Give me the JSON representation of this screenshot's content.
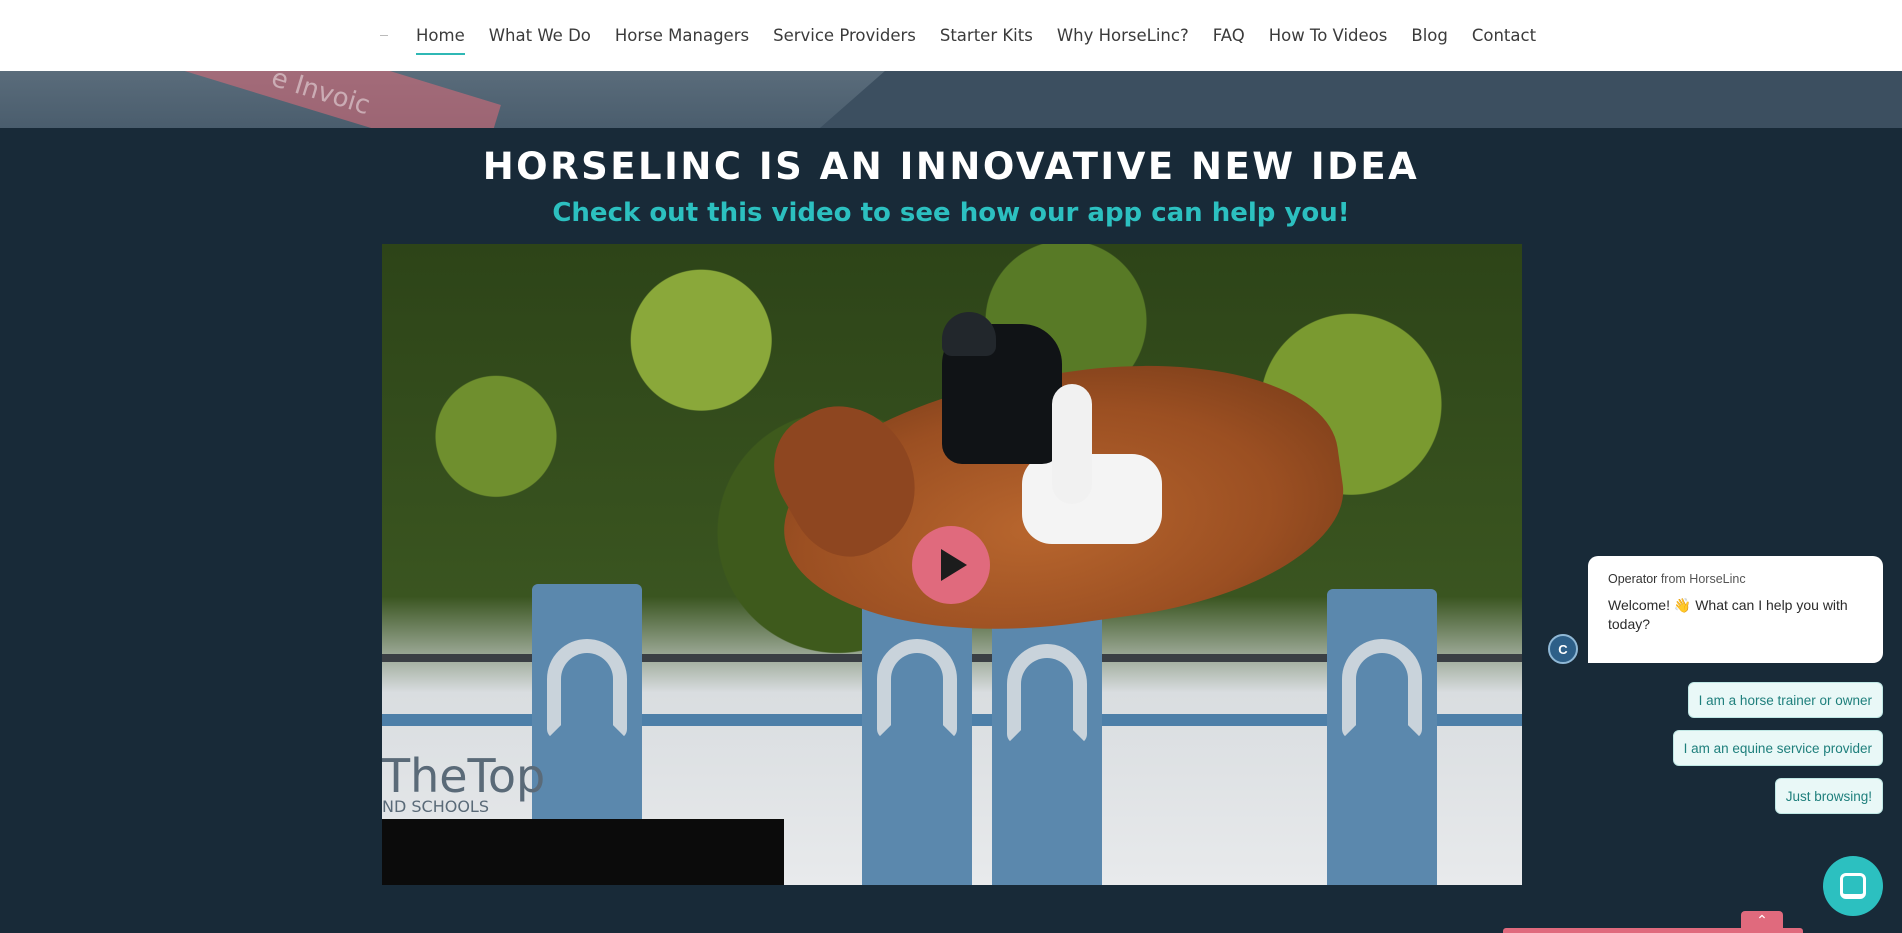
{
  "nav": {
    "items": [
      {
        "label": "Home",
        "active": true
      },
      {
        "label": "What We Do"
      },
      {
        "label": "Horse Managers"
      },
      {
        "label": "Service Providers"
      },
      {
        "label": "Starter Kits"
      },
      {
        "label": "Why HorseLinc?"
      },
      {
        "label": "FAQ"
      },
      {
        "label": "How To Videos"
      },
      {
        "label": "Blog"
      },
      {
        "label": "Contact"
      }
    ]
  },
  "hero": {
    "ribbon_text": "e Invoic"
  },
  "main": {
    "headline": "HORSELINC IS AN INNOVATIVE NEW IDEA",
    "subline": "Check out this video to see how our app can help you!"
  },
  "video": {
    "logo_text": "TheTop",
    "logo_sub": "ND SCHOOLS"
  },
  "chat": {
    "operator": "Operator",
    "from_text": "from HorseLinc",
    "welcome": "Welcome! 👋 What can I help you with today?",
    "avatar_text": "C",
    "options": [
      "I am a horse trainer or owner",
      "I am an equine service provider",
      "Just browsing!"
    ]
  },
  "colors": {
    "accent": "#2cc0c0",
    "play": "#e06a7d",
    "background": "#182a38"
  },
  "icons": {
    "play": "play-icon",
    "launcher": "chat-launcher-icon",
    "to_top": "chevron-up-icon"
  }
}
